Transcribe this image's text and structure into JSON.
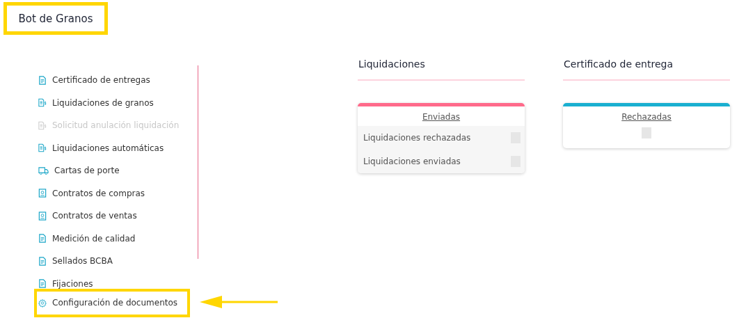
{
  "header": {
    "title": "Bot de Granos",
    "highlighted": true
  },
  "sidebar": {
    "items": [
      {
        "label": "Certificado de entregas",
        "kind": "document",
        "disabled": false,
        "highlighted": false
      },
      {
        "label": "Liquidaciones de granos",
        "kind": "invoice",
        "disabled": false,
        "highlighted": false
      },
      {
        "label": "Solicitud anulación liquidación",
        "kind": "invoice",
        "disabled": true,
        "highlighted": false
      },
      {
        "label": "Liquidaciones automáticas",
        "kind": "invoice",
        "disabled": false,
        "highlighted": false
      },
      {
        "label": "Cartas de porte",
        "kind": "truck",
        "disabled": false,
        "highlighted": false
      },
      {
        "label": "Contratos de compras",
        "kind": "contract",
        "disabled": false,
        "highlighted": false
      },
      {
        "label": "Contratos de ventas",
        "kind": "contract",
        "disabled": false,
        "highlighted": false
      },
      {
        "label": "Medición de calidad",
        "kind": "document",
        "disabled": false,
        "highlighted": false
      },
      {
        "label": "Sellados BCBA",
        "kind": "document",
        "disabled": false,
        "highlighted": false
      },
      {
        "label": "Fijaciones",
        "kind": "document",
        "disabled": false,
        "highlighted": false
      },
      {
        "label": "Configuración de documentos",
        "kind": "gear",
        "disabled": false,
        "highlighted": true
      }
    ]
  },
  "sections": [
    {
      "title": "Liquidaciones",
      "color": "#ff6b8b",
      "link": "Enviadas",
      "rows": [
        "Liquidaciones rechazadas",
        "Liquidaciones enviadas"
      ]
    },
    {
      "title": "Certificado de entrega",
      "color": "#1aafd0",
      "link": "Rechazadas"
    }
  ]
}
